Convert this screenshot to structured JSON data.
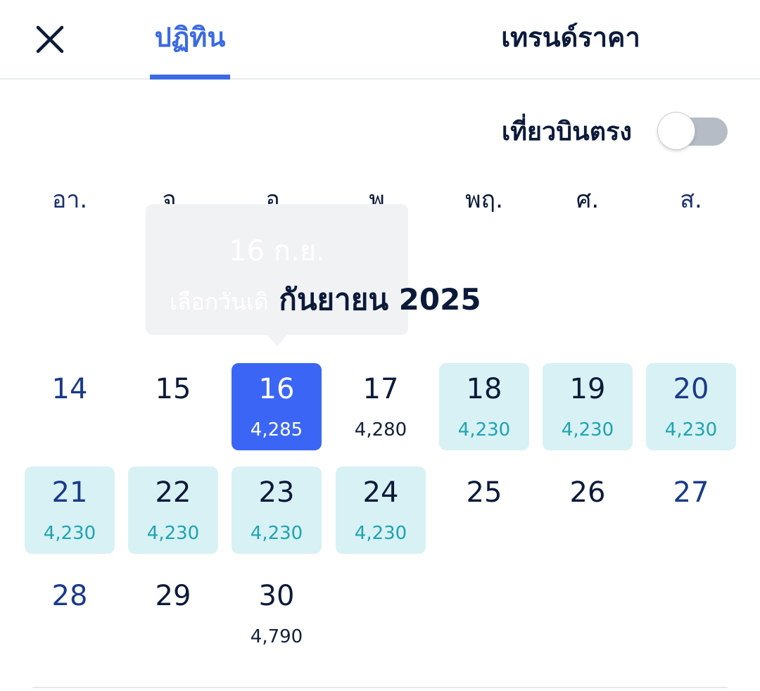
{
  "header": {
    "close_icon": "close-icon",
    "tabs": [
      {
        "label": "ปฏิทิน",
        "active": true
      },
      {
        "label": "เทรนด์ราคา",
        "active": false
      }
    ]
  },
  "filter": {
    "direct_flight_label": "เที่ยวบินตรง",
    "direct_flight_enabled": false
  },
  "weekdays": [
    "อา.",
    "จ.",
    "อ.",
    "พ.",
    "พฤ.",
    "ศ.",
    "ส."
  ],
  "tooltip": {
    "date": "16 ก.ย.",
    "hint": "เลือกวันเดิ"
  },
  "month_title": "กันยายน 2025",
  "days": [
    {
      "day": "14",
      "price": "",
      "state": "normal"
    },
    {
      "day": "15",
      "price": "",
      "state": "normal"
    },
    {
      "day": "16",
      "price": "4,285",
      "state": "selected"
    },
    {
      "day": "17",
      "price": "4,280",
      "state": "normal"
    },
    {
      "day": "18",
      "price": "4,230",
      "state": "cheap"
    },
    {
      "day": "19",
      "price": "4,230",
      "state": "cheap"
    },
    {
      "day": "20",
      "price": "4,230",
      "state": "cheap"
    },
    {
      "day": "21",
      "price": "4,230",
      "state": "cheap"
    },
    {
      "day": "22",
      "price": "4,230",
      "state": "cheap"
    },
    {
      "day": "23",
      "price": "4,230",
      "state": "cheap"
    },
    {
      "day": "24",
      "price": "4,230",
      "state": "cheap"
    },
    {
      "day": "25",
      "price": "",
      "state": "normal"
    },
    {
      "day": "26",
      "price": "",
      "state": "normal"
    },
    {
      "day": "27",
      "price": "",
      "state": "normal"
    },
    {
      "day": "28",
      "price": "",
      "state": "normal"
    },
    {
      "day": "29",
      "price": "",
      "state": "normal"
    },
    {
      "day": "30",
      "price": "4,790",
      "state": "normal"
    }
  ],
  "colors": {
    "accent": "#3b66f5",
    "cheap_bg": "#d8f1f4",
    "cheap_price": "#1fa3b3",
    "text": "#0c1a3a"
  }
}
